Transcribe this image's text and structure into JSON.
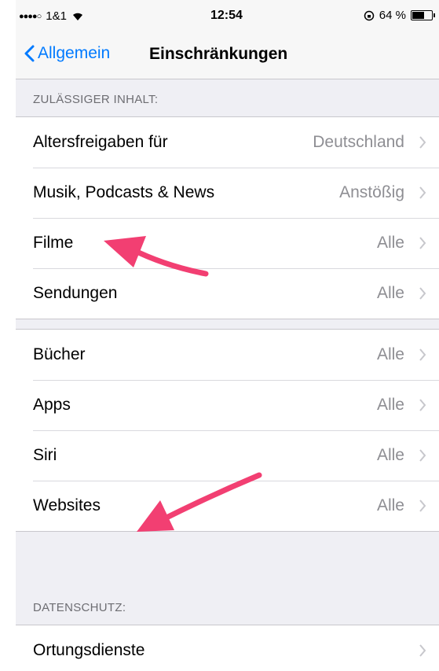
{
  "status": {
    "carrier": "1&1",
    "time": "12:54",
    "battery_percent": "64 %",
    "battery_level": 0.64
  },
  "nav": {
    "back_label": "Allgemein",
    "title": "Einschränkungen"
  },
  "sections": {
    "allowed_header": "ZULÄSSIGER INHALT:",
    "privacy_header": "DATENSCHUTZ:"
  },
  "group1": [
    {
      "label": "Altersfreigaben für",
      "value": "Deutschland"
    },
    {
      "label": "Musik, Podcasts & News",
      "value": "Anstößig"
    },
    {
      "label": "Filme",
      "value": "Alle"
    },
    {
      "label": "Sendungen",
      "value": "Alle"
    }
  ],
  "group2": [
    {
      "label": "Bücher",
      "value": "Alle"
    },
    {
      "label": "Apps",
      "value": "Alle"
    },
    {
      "label": "Siri",
      "value": "Alle"
    },
    {
      "label": "Websites",
      "value": "Alle"
    }
  ],
  "group3": [
    {
      "label": "Ortungsdienste",
      "value": ""
    }
  ],
  "colors": {
    "accent": "#007aff",
    "annotation_arrow": "#f23f72"
  }
}
